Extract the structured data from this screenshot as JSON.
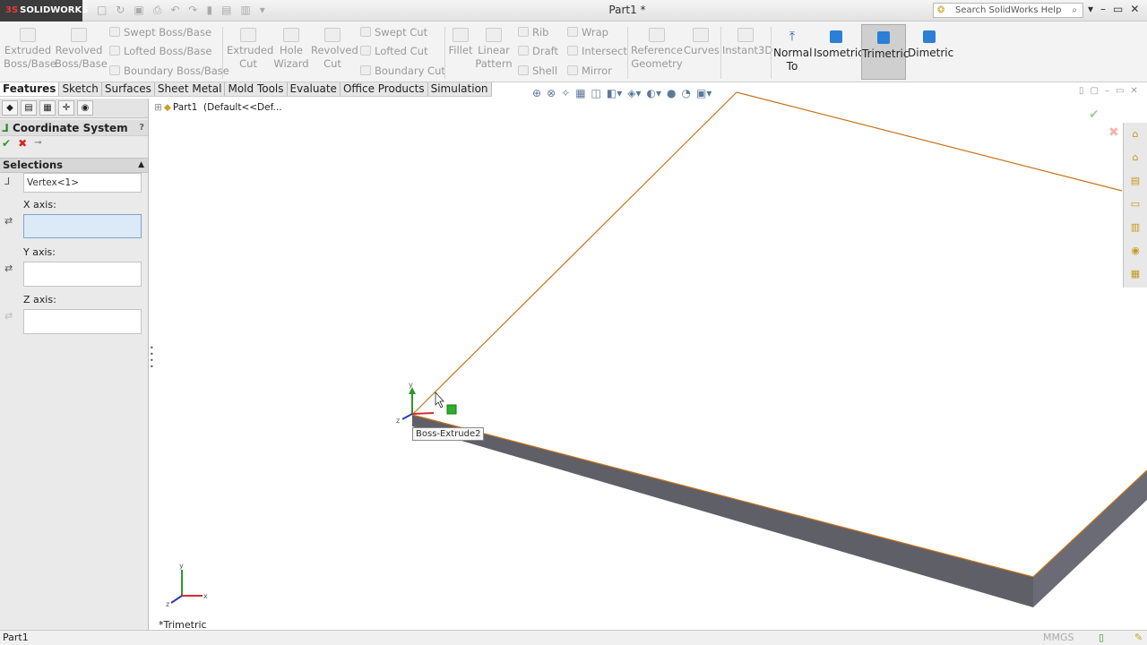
{
  "app": {
    "brand": "SOLIDWORKS",
    "brand_prefix": "3S",
    "document_title": "Part1 *",
    "search_placeholder": "Search SolidWorks Help"
  },
  "ribbon": {
    "extruded_boss": "Extruded\nBoss/Base",
    "extruded_boss_l1": "Extruded",
    "extruded_boss_l2": "Boss/Base",
    "revolved_boss_l1": "Revolved",
    "revolved_boss_l2": "Boss/Base",
    "swept_boss": "Swept Boss/Base",
    "lofted_boss": "Lofted Boss/Base",
    "boundary_boss": "Boundary Boss/Base",
    "extruded_cut_l1": "Extruded",
    "extruded_cut_l2": "Cut",
    "hole_wizard_l1": "Hole",
    "hole_wizard_l2": "Wizard",
    "revolved_cut_l1": "Revolved",
    "revolved_cut_l2": "Cut",
    "swept_cut": "Swept Cut",
    "lofted_cut": "Lofted Cut",
    "boundary_cut": "Boundary Cut",
    "fillet": "Fillet",
    "linear_pattern_l1": "Linear",
    "linear_pattern_l2": "Pattern",
    "rib": "Rib",
    "draft": "Draft",
    "shell": "Shell",
    "wrap": "Wrap",
    "intersect": "Intersect",
    "mirror": "Mirror",
    "ref_geom_l1": "Reference",
    "ref_geom_l2": "Geometry",
    "curves": "Curves",
    "instant3d": "Instant3D",
    "normal_to_l1": "Normal",
    "normal_to_l2": "To",
    "isometric": "Isometric",
    "trimetric": "Trimetric",
    "dimetric": "Dimetric"
  },
  "tabs": [
    "Features",
    "Sketch",
    "Surfaces",
    "Sheet Metal",
    "Mold Tools",
    "Evaluate",
    "Office Products",
    "Simulation"
  ],
  "property_manager": {
    "title": "Coordinate System",
    "help": "?",
    "selections_label": "Selections",
    "origin_value": "Vertex<1>",
    "x_axis_label": "X axis:",
    "x_axis_value": "",
    "y_axis_label": "Y axis:",
    "y_axis_value": "",
    "z_axis_label": "Z axis:",
    "z_axis_value": ""
  },
  "graphics": {
    "tree_part": "Part1",
    "tree_config": "(Default<<Def...",
    "tooltip": "Boss-Extrude2",
    "view_label": "*Trimetric",
    "triad_x": "x",
    "triad_y": "y",
    "triad_z": "z"
  },
  "status": {
    "left_text": "Part1",
    "units": "MMGS"
  },
  "colors": {
    "edge_highlight": "#c8741a",
    "side_face": "#5f5f68",
    "active_view": "#2b7fd4"
  }
}
